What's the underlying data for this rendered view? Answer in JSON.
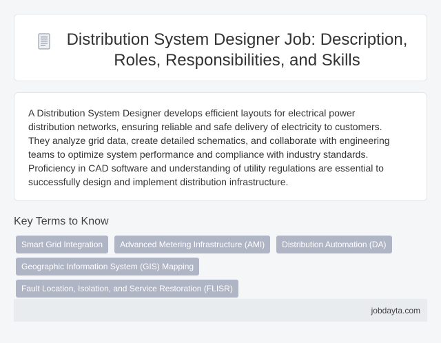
{
  "header": {
    "icon": "document-icon",
    "title": "Distribution System Designer Job: Description, Roles, Responsibilities, and Skills"
  },
  "description": {
    "text": "A Distribution System Designer develops efficient layouts for electrical power distribution networks, ensuring reliable and safe delivery of electricity to customers. They analyze grid data, create detailed schematics, and collaborate with engineering teams to optimize system performance and compliance with industry standards. Proficiency in CAD software and understanding of utility regulations are essential to successfully design and implement distribution infrastructure."
  },
  "key_terms": {
    "heading": "Key Terms to Know",
    "tags": [
      "Smart Grid Integration",
      "Advanced Metering Infrastructure (AMI)",
      "Distribution Automation (DA)",
      "Geographic Information System (GIS) Mapping",
      "Fault Location, Isolation, and Service Restoration (FLISR)"
    ]
  },
  "footer": {
    "site": "jobdayta.com"
  },
  "colors": {
    "background": "#f5f6f8",
    "card": "#ffffff",
    "tag": "#b0b5c6",
    "footer": "#e9ecef"
  }
}
